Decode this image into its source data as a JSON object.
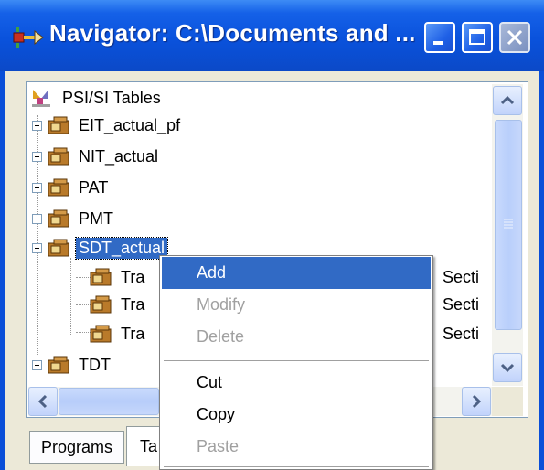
{
  "window": {
    "title": "Navigator: C:\\Documents and ...",
    "controls": [
      "minimize",
      "maximize",
      "close"
    ]
  },
  "tree": {
    "root_label": "PSI/SI Tables",
    "items": [
      {
        "label": "EIT_actual_pf",
        "expander": "plus"
      },
      {
        "label": "NIT_actual",
        "expander": "plus"
      },
      {
        "label": "PAT",
        "expander": "plus"
      },
      {
        "label": "PMT",
        "expander": "plus"
      },
      {
        "label": "SDT_actual",
        "expander": "minus",
        "selected": true
      },
      {
        "label": "TDT",
        "expander": "plus"
      }
    ],
    "children": [
      {
        "left_text": "Tra",
        "right_text": "Secti"
      },
      {
        "left_text": "Tra",
        "right_text": "Secti"
      },
      {
        "left_text": "Tra",
        "right_text": "Secti"
      }
    ]
  },
  "context_menu": {
    "items": [
      {
        "label": "Add",
        "state": "highlighted"
      },
      {
        "label": "Modify",
        "state": "disabled"
      },
      {
        "label": "Delete",
        "state": "disabled"
      },
      {
        "label": "Cut",
        "state": "enabled"
      },
      {
        "label": "Copy",
        "state": "enabled"
      },
      {
        "label": "Paste",
        "state": "disabled"
      }
    ]
  },
  "tabs": [
    {
      "label": "Programs",
      "active": false
    },
    {
      "label": "Ta",
      "active": true
    }
  ],
  "colors": {
    "title_bar": "#0a52dc",
    "selection": "#316ac5",
    "window_bg": "#ece9d8"
  }
}
